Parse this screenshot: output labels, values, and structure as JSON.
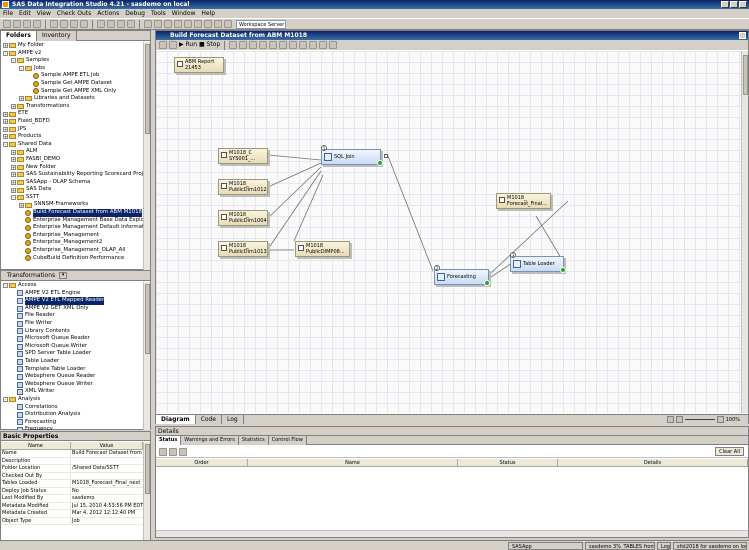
{
  "window": {
    "title": "SAS Data Integration Studio 4.21 - sasdemo on local"
  },
  "menu": [
    "File",
    "Edit",
    "View",
    "Check Outs",
    "Actions",
    "Debug",
    "Tools",
    "Window",
    "Help"
  ],
  "toolbar": {
    "server_select": "Workspace Server"
  },
  "left_panel": {
    "tabs": [
      "Folders",
      "Inventory"
    ],
    "tree": [
      {
        "indent": 0,
        "expander": "+",
        "icon": "folder",
        "label": "My Folder"
      },
      {
        "indent": 0,
        "expander": "-",
        "icon": "folder",
        "label": "AMPE v2"
      },
      {
        "indent": 1,
        "expander": "-",
        "icon": "folder",
        "label": "Samples"
      },
      {
        "indent": 2,
        "expander": "-",
        "icon": "folder",
        "label": "Jobs"
      },
      {
        "indent": 3,
        "expander": "",
        "icon": "gear",
        "label": "Sample AMPE ETL Job"
      },
      {
        "indent": 3,
        "expander": "",
        "icon": "gear",
        "label": "Sample Get AMPE Dataset"
      },
      {
        "indent": 3,
        "expander": "",
        "icon": "gear",
        "label": "Sample Get AMPE XML Only"
      },
      {
        "indent": 2,
        "expander": "+",
        "icon": "folder",
        "label": "Libraries and Datasets"
      },
      {
        "indent": 1,
        "expander": "+",
        "icon": "folder",
        "label": "Transformations"
      },
      {
        "indent": 0,
        "expander": "+",
        "icon": "folder",
        "label": "ETE"
      },
      {
        "indent": 0,
        "expander": "+",
        "icon": "folder",
        "label": "Fixed_BDFD"
      },
      {
        "indent": 0,
        "expander": "+",
        "icon": "folder",
        "label": "JPS"
      },
      {
        "indent": 0,
        "expander": "+",
        "icon": "folder",
        "label": "Products"
      },
      {
        "indent": 0,
        "expander": "-",
        "icon": "folder",
        "label": "Shared Data"
      },
      {
        "indent": 1,
        "expander": "+",
        "icon": "folder",
        "label": "ALM"
      },
      {
        "indent": 1,
        "expander": "+",
        "icon": "folder",
        "label": "FASBI_DEMO"
      },
      {
        "indent": 1,
        "expander": "+",
        "icon": "folder",
        "label": "New Folder"
      },
      {
        "indent": 1,
        "expander": "+",
        "icon": "folder",
        "label": "SAS Sustainability Reporting Scorecard Projects"
      },
      {
        "indent": 1,
        "expander": "+",
        "icon": "folder",
        "label": "SASApp - OLAP Schema"
      },
      {
        "indent": 1,
        "expander": "+",
        "icon": "folder",
        "label": "SAS Data"
      },
      {
        "indent": 1,
        "expander": "-",
        "icon": "folder",
        "label": "SSTT"
      },
      {
        "indent": 2,
        "expander": "+",
        "icon": "folder",
        "label": "SNNSM-Frameworks"
      },
      {
        "indent": 2,
        "expander": "",
        "icon": "gear",
        "label": "Build Forecast Dataset from ABM M1018",
        "selected": true
      },
      {
        "indent": 2,
        "expander": "",
        "icon": "gear",
        "label": "Enterprise Management Base Data Exploration"
      },
      {
        "indent": 2,
        "expander": "",
        "icon": "gear",
        "label": "Enterprise Management Default Information"
      },
      {
        "indent": 2,
        "expander": "",
        "icon": "gear",
        "label": "Enterprise_Management"
      },
      {
        "indent": 2,
        "expander": "",
        "icon": "gear",
        "label": "Enterprise_Management2"
      },
      {
        "indent": 2,
        "expander": "",
        "icon": "gear",
        "label": "Enterprise_Management_OLAP_All"
      },
      {
        "indent": 2,
        "expander": "",
        "icon": "gear",
        "label": "CubeBuild Definition Performance"
      }
    ]
  },
  "transformations_panel": {
    "title": "Transformations",
    "tree": [
      {
        "indent": 0,
        "expander": "-",
        "icon": "folder",
        "label": "Access"
      },
      {
        "indent": 1,
        "expander": "",
        "icon": "trans",
        "label": "AMPE V2 ETL Engine"
      },
      {
        "indent": 1,
        "expander": "",
        "icon": "trans",
        "label": "AMPE V2 ETL Mapped Reader",
        "selected": true
      },
      {
        "indent": 1,
        "expander": "",
        "icon": "trans",
        "label": "AMPE V2 GET XML Only"
      },
      {
        "indent": 1,
        "expander": "",
        "icon": "trans",
        "label": "File Reader"
      },
      {
        "indent": 1,
        "expander": "",
        "icon": "trans",
        "label": "File Writer"
      },
      {
        "indent": 1,
        "expander": "",
        "icon": "trans",
        "label": "Library Contents"
      },
      {
        "indent": 1,
        "expander": "",
        "icon": "trans",
        "label": "Microsoft Queue Reader"
      },
      {
        "indent": 1,
        "expander": "",
        "icon": "trans",
        "label": "Microsoft Queue Writer"
      },
      {
        "indent": 1,
        "expander": "",
        "icon": "trans",
        "label": "SPD Server Table Loader"
      },
      {
        "indent": 1,
        "expander": "",
        "icon": "trans",
        "label": "Table Loader"
      },
      {
        "indent": 1,
        "expander": "",
        "icon": "trans",
        "label": "Template Table Loader"
      },
      {
        "indent": 1,
        "expander": "",
        "icon": "trans",
        "label": "Websphere Queue Reader"
      },
      {
        "indent": 1,
        "expander": "",
        "icon": "trans",
        "label": "Websphere Queue Writer"
      },
      {
        "indent": 1,
        "expander": "",
        "icon": "trans",
        "label": "XML Writer"
      },
      {
        "indent": 0,
        "expander": "-",
        "icon": "folder",
        "label": "Analysis"
      },
      {
        "indent": 1,
        "expander": "",
        "icon": "trans",
        "label": "Correlations"
      },
      {
        "indent": 1,
        "expander": "",
        "icon": "trans",
        "label": "Distribution Analysis"
      },
      {
        "indent": 1,
        "expander": "",
        "icon": "trans",
        "label": "Forecasting"
      },
      {
        "indent": 1,
        "expander": "",
        "icon": "trans",
        "label": "Frequency"
      }
    ]
  },
  "properties_panel": {
    "title": "Basic Properties",
    "col_name": "Name",
    "col_value": "Value",
    "rows": [
      {
        "name": "Name",
        "value": "Build Forecast Dataset from ..."
      },
      {
        "name": "Description",
        "value": ""
      },
      {
        "name": "Folder Location",
        "value": "/Shared Data/SSTT"
      },
      {
        "name": "Checked Out By",
        "value": ""
      },
      {
        "name": "Tables Loaded",
        "value": "M1018_Forecast_Final_next"
      },
      {
        "name": "Deploy Job Status",
        "value": "No"
      },
      {
        "name": "Last Modified By",
        "value": "sasdemo"
      },
      {
        "name": "Metadata Modified",
        "value": "Jul 15, 2010 4:53:56 PM EDT"
      },
      {
        "name": "Metadata Created",
        "value": "Mar 4, 2012 12:12:40 PM"
      },
      {
        "name": "Object Type",
        "value": "Job"
      }
    ]
  },
  "editor": {
    "title": "Build Forecast Dataset from ABM M1018",
    "run_label": "Run",
    "stop_label": "Stop",
    "tabs": [
      "Diagram",
      "Code",
      "Log"
    ],
    "zoom": "100%",
    "nodes": [
      {
        "id": "note",
        "kind": "note",
        "line1": "ABM Report",
        "line2": "21453"
      },
      {
        "id": "t1",
        "kind": "table",
        "line1": "M1018_C",
        "line2": "SYS001_..."
      },
      {
        "id": "t2",
        "kind": "table",
        "line1": "M1018_",
        "line2": "PublicDim1012"
      },
      {
        "id": "t3",
        "kind": "table",
        "line1": "M1018_",
        "line2": "PublicDim1004"
      },
      {
        "id": "t4",
        "kind": "table",
        "line1": "M1018_",
        "line2": "PublicDim1013"
      },
      {
        "id": "t5",
        "kind": "table",
        "line1": "M1018",
        "line2": "PublicDIMP08..."
      },
      {
        "id": "sql",
        "kind": "transform",
        "line1": "SQL Join",
        "num": "1"
      },
      {
        "id": "fc",
        "kind": "transform",
        "line1": "Forecasting",
        "num": "2"
      },
      {
        "id": "tl",
        "kind": "transform",
        "line1": "Table Loader",
        "num": "3"
      },
      {
        "id": "t6",
        "kind": "table",
        "line1": "M1018_",
        "line2": "Forecast_Final..."
      }
    ]
  },
  "details": {
    "title": "Details",
    "tabs": [
      "Status",
      "Warnings and Errors",
      "Statistics",
      "Control Flow"
    ],
    "clear_label": "Clear All",
    "columns": [
      "Order",
      "Name",
      "Status",
      "Details"
    ]
  },
  "statusbar": {
    "items": [
      "SASApp",
      "sasdemo 3%_TABLES from Connect...",
      "Log",
      "sfst2018 for sasdemo on local"
    ]
  }
}
